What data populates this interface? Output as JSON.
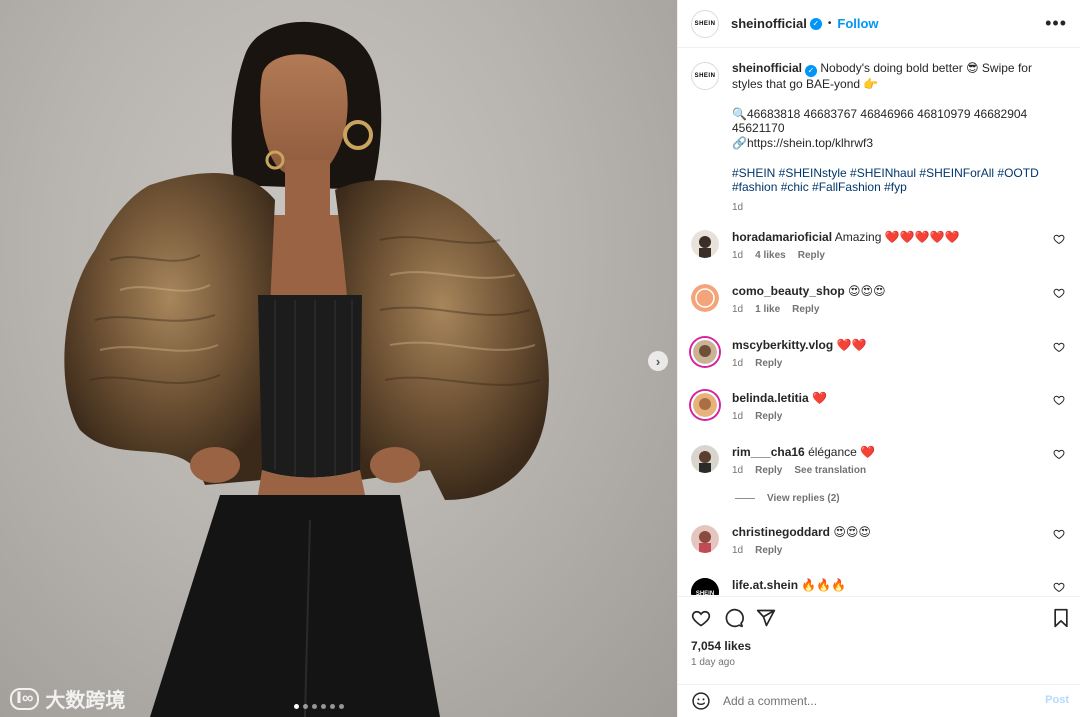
{
  "account": {
    "avatar_text": "SHEIN",
    "username": "sheinofficial",
    "separator": "•",
    "follow_label": "Follow",
    "more_label": "•••"
  },
  "caption": {
    "username": "sheinofficial",
    "text_line1": "Nobody's doing bold better 😎 Swipe for styles that go BAE-yond 👉",
    "codes": "🔍46683818 46683767 46846966 46810979 46682904 45621170",
    "link": "🔗https://shein.top/klhrwf3",
    "hashtags": "#SHEIN #SHEINstyle #SHEINhaul #SHEINForAll #OOTD #fashion #chic #FallFashion #fyp",
    "time": "1d"
  },
  "comments": [
    {
      "username": "horadamarioficial",
      "text": "Amazing ❤️❤️❤️❤️❤️",
      "time": "1d",
      "likes": "4 likes",
      "reply": "Reply",
      "translate": ""
    },
    {
      "username": "como_beauty_shop",
      "text": "😍😍😍",
      "time": "1d",
      "likes": "1 like",
      "reply": "Reply",
      "translate": ""
    },
    {
      "username": "mscyberkitty.vlog",
      "text": "❤️❤️",
      "time": "1d",
      "likes": "",
      "reply": "Reply",
      "translate": ""
    },
    {
      "username": "belinda.letitia",
      "text": "❤️",
      "time": "1d",
      "likes": "",
      "reply": "Reply",
      "translate": ""
    },
    {
      "username": "rim___cha16",
      "text": "élégance ❤️",
      "time": "1d",
      "likes": "",
      "reply": "Reply",
      "translate": "See translation"
    },
    {
      "username": "christinegoddard",
      "text": "😍😍😍",
      "time": "1d",
      "likes": "",
      "reply": "Reply",
      "translate": ""
    },
    {
      "username": "life.at.shein",
      "text": "🔥🔥🔥",
      "time": "",
      "likes": "",
      "reply": "",
      "translate": ""
    }
  ],
  "view_replies": "View replies (2)",
  "stats": {
    "likes": "7,054 likes",
    "date": "1 day ago"
  },
  "composer": {
    "placeholder": "Add a comment...",
    "post_label": "Post"
  },
  "media": {
    "next_arrow": "›",
    "slide_count": 6,
    "active_slide": 1,
    "watermark_logo": "Ⅰ∞",
    "watermark_text": "大数跨境"
  },
  "colors": {
    "accent": "#0095f6",
    "hashtag": "#00376b",
    "muted": "#737373",
    "story_ring": "#d6249f"
  }
}
